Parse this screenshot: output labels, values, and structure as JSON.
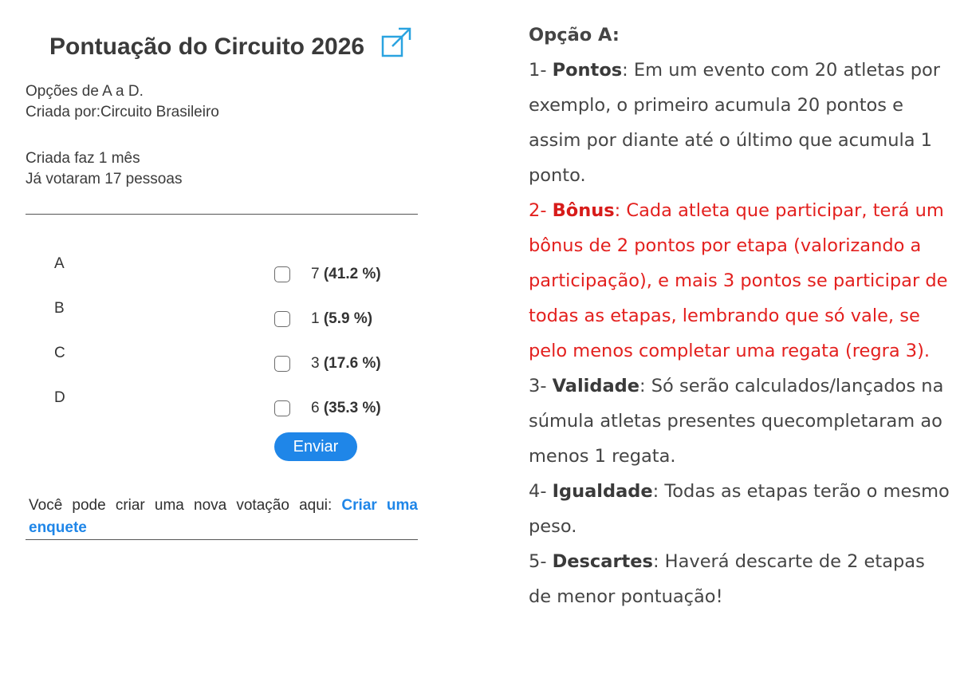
{
  "poll": {
    "title": "Pontuação do Circuito 2026",
    "subtitle": "Opções de A a D.",
    "created_by": "Criada por:Circuito Brasileiro",
    "created_ago": "Criada faz 1 mês",
    "voters": "Já votaram 17 pessoas",
    "options": [
      {
        "label": "A",
        "count": "7",
        "percent": "(41.2 %)"
      },
      {
        "label": "B",
        "count": "1",
        "percent": "(5.9 %)"
      },
      {
        "label": "C",
        "count": "3",
        "percent": "(17.6 %)"
      },
      {
        "label": "D",
        "count": "6",
        "percent": "(35.3 %)"
      }
    ],
    "submit_label": "Enviar",
    "footer_text": "Você pode criar uma nova votação aqui:",
    "footer_link": "Criar uma enquete",
    "icon": "expand-icon"
  },
  "rules": {
    "heading": "Opção A:",
    "items": [
      {
        "prefix": "1- ",
        "title": "Pontos",
        "text": ": Em um evento com 20 atletas por exemplo, o primeiro acumula 20 pontos e assim por diante até o último que acumula 1 ponto."
      },
      {
        "prefix": "2- ",
        "title": "Bônus",
        "text": ": Cada atleta que participar, terá um bônus de 2 pontos por etapa (valorizando a participação), e mais 3 pontos se participar de todas as etapas, lembrando que só vale, se pelo menos completar uma regata (regra 3)."
      },
      {
        "prefix": "3- ",
        "title": "Validade",
        "text": ": Só serão calculados/lançados na súmula atletas presentes quecompletaram ao menos 1 regata."
      },
      {
        "prefix": "4- ",
        "title": "Igualdade",
        "text": ": Todas as etapas terão o mesmo peso."
      },
      {
        "prefix": "5- ",
        "title": "Descartes",
        "text": ": Haverá descarte de 2 etapas de menor pontuação!"
      }
    ]
  },
  "colors": {
    "accent": "#1f86e8",
    "highlight_red": "#e3201e",
    "text": "#454545"
  }
}
